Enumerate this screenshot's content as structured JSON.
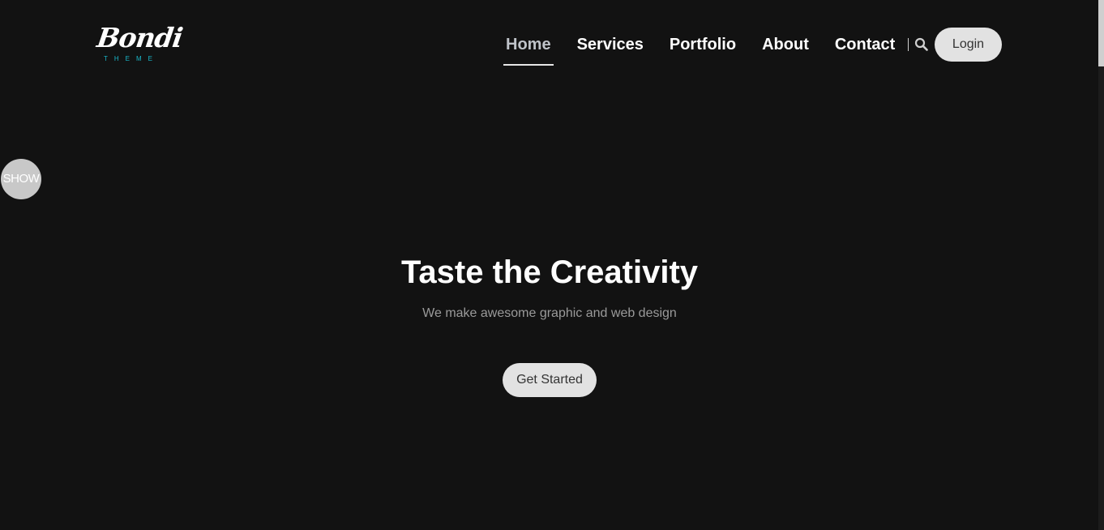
{
  "brand": {
    "logo_text": "Bondi",
    "logo_subtext": "THEME",
    "accent_color": "#19b7c9"
  },
  "nav": {
    "items": [
      {
        "label": "Home",
        "active": true
      },
      {
        "label": "Services",
        "active": false
      },
      {
        "label": "Portfolio",
        "active": false
      },
      {
        "label": "About",
        "active": false
      },
      {
        "label": "Contact",
        "active": false
      }
    ],
    "search_icon": "search-icon",
    "login_label": "Login"
  },
  "side": {
    "show_label": "SHOW"
  },
  "hero": {
    "title": "Taste the Creativity",
    "subtitle": "We make awesome graphic and web design",
    "cta_label": "Get Started"
  },
  "colors": {
    "background": "#121212",
    "button_bg": "#e2e2e2",
    "nav_active": "#bfc3c9"
  }
}
